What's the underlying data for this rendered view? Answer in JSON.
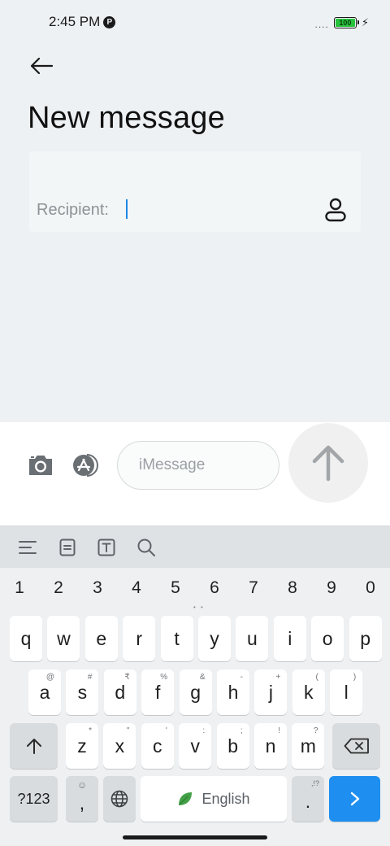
{
  "status_bar": {
    "time": "2:45 PM",
    "battery_level": "100",
    "signal": "....",
    "p_badge": "P",
    "bolt": "⚡"
  },
  "header": {
    "title": "New message"
  },
  "recipient": {
    "label": "Recipient:"
  },
  "compose": {
    "placeholder": "iMessage"
  },
  "keyboard": {
    "numbers": [
      "1",
      "2",
      "3",
      "4",
      "5",
      "6",
      "7",
      "8",
      "9",
      "0"
    ],
    "pager": "• •",
    "row1": [
      {
        "k": "q",
        "s": ""
      },
      {
        "k": "w",
        "s": ""
      },
      {
        "k": "e",
        "s": ""
      },
      {
        "k": "r",
        "s": ""
      },
      {
        "k": "t",
        "s": ""
      },
      {
        "k": "y",
        "s": ""
      },
      {
        "k": "u",
        "s": ""
      },
      {
        "k": "i",
        "s": ""
      },
      {
        "k": "o",
        "s": ""
      },
      {
        "k": "p",
        "s": ""
      }
    ],
    "row2": [
      {
        "k": "a",
        "s": "@"
      },
      {
        "k": "s",
        "s": "#"
      },
      {
        "k": "d",
        "s": "₹"
      },
      {
        "k": "f",
        "s": "%"
      },
      {
        "k": "g",
        "s": "&"
      },
      {
        "k": "h",
        "s": "-"
      },
      {
        "k": "j",
        "s": "+"
      },
      {
        "k": "k",
        "s": "("
      },
      {
        "k": "l",
        "s": ")"
      }
    ],
    "row3": [
      {
        "k": "z",
        "s": "*"
      },
      {
        "k": "x",
        "s": "\""
      },
      {
        "k": "c",
        "s": "'"
      },
      {
        "k": "v",
        "s": ":"
      },
      {
        "k": "b",
        "s": ";"
      },
      {
        "k": "n",
        "s": "!"
      },
      {
        "k": "m",
        "s": "?"
      }
    ],
    "symbols_label": "?123",
    "comma": ",",
    "emoji_hint": "☺",
    "space_label": "English",
    "period": ".",
    "period_hint": ",!?"
  },
  "colors": {
    "accent": "#1e8ff0",
    "caret": "#1e88e5",
    "battery": "#27c33b"
  }
}
